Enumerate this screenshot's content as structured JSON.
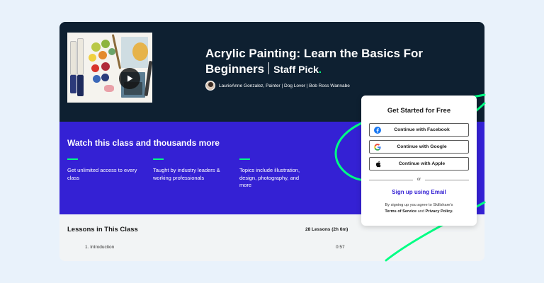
{
  "class": {
    "title": "Acrylic Painting: Learn the Basics For Beginners",
    "badge": "Staff Pick",
    "badge_dot": ".",
    "byline": "LaurieAnne Gonzalez, Painter | Dog Lover | Bob Ross Wannabe"
  },
  "promo": {
    "title": "Watch this class and thousands more",
    "features": [
      "Get unlimited access to every class",
      "Taught by industry leaders & working professionals",
      "Topics include illustration, design, photography, and more"
    ]
  },
  "lessons": {
    "title": "Lessons in This Class",
    "count": "28 Lessons (2h 6m)",
    "items": [
      {
        "name": "1. Introduction",
        "duration": "0:57"
      }
    ]
  },
  "signup": {
    "title": "Get Started for Free",
    "facebook": "Continue with Facebook",
    "google": "Continue with Google",
    "apple": "Continue with Apple",
    "or": "or",
    "email": "Sign up using Email",
    "terms_prefix": "By signing up you agree to Skillshare's",
    "terms_link": "Terms of Service",
    "terms_and": "and",
    "privacy_link": "Privacy Policy."
  },
  "icons": {
    "play": "play-icon",
    "facebook": "facebook-icon",
    "google": "google-icon",
    "apple": "apple-icon"
  },
  "colors": {
    "hero_bg": "#0e2031",
    "band_bg": "#3421d4",
    "accent_green": "#00ff84",
    "link_purple": "#3421d4"
  }
}
